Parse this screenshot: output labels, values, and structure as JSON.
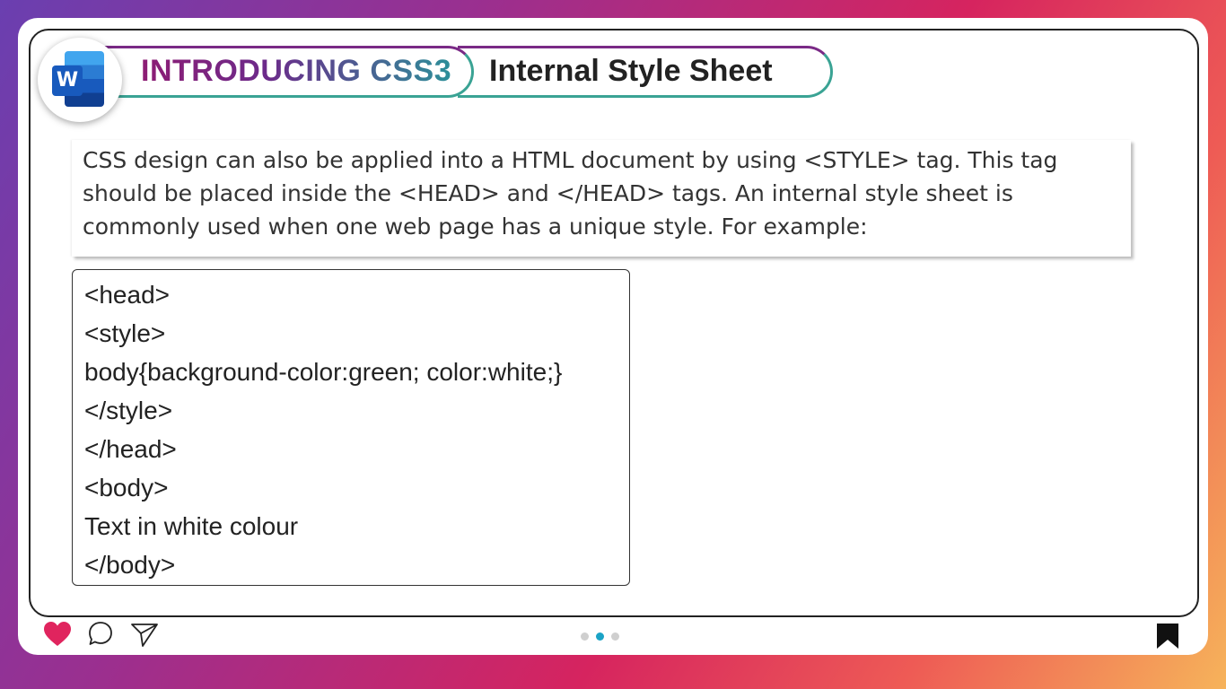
{
  "header": {
    "title": "INTRODUCING CSS3",
    "subtitle": "Internal Style Sheet",
    "app_icon": "word-icon",
    "app_icon_letter": "W"
  },
  "description": "CSS design can also be applied into a HTML document by using <STYLE> tag. This tag should be placed inside the <HEAD> and </HEAD> tags. An internal style sheet is commonly used when one web page has a unique style. For example:",
  "code_lines": [
    "<head>",
    "<style>",
    "body{background-color:green; color:white;}",
    "</style>",
    "</head>",
    "<body>",
    "Text in white colour",
    "</body>"
  ],
  "footer": {
    "icons": [
      "heart-icon",
      "comment-icon",
      "send-icon",
      "bookmark-icon"
    ],
    "pagination": {
      "total": 3,
      "active": 2
    },
    "heart_color": "#e0245e",
    "active_dot_color": "#1ba3c6"
  }
}
